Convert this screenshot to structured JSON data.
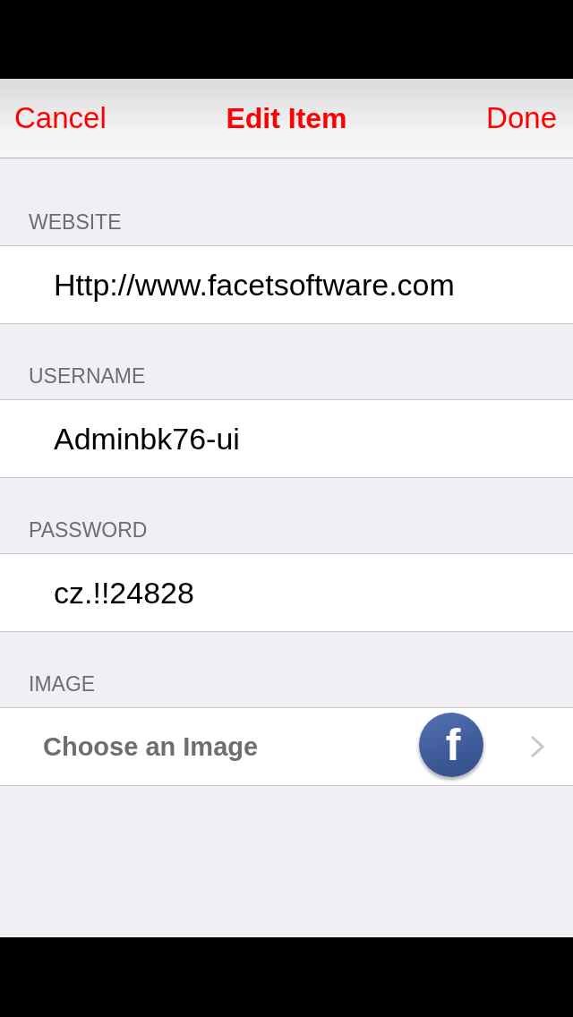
{
  "nav_bar": {
    "cancel": "Cancel",
    "title": "Edit Item",
    "done": "Done"
  },
  "sections": [
    {
      "header": "WEBSITE",
      "kind": "field",
      "value": "Http://www.facetsoftware.com"
    },
    {
      "header": "USERNAME",
      "kind": "field",
      "value": "Adminbk76-ui"
    },
    {
      "header": "PASSWORD",
      "kind": "field",
      "value": "cz.!!24828"
    },
    {
      "header": "IMAGE",
      "kind": "picker",
      "label": "Choose an Image",
      "logo_letter": "f"
    }
  ]
}
